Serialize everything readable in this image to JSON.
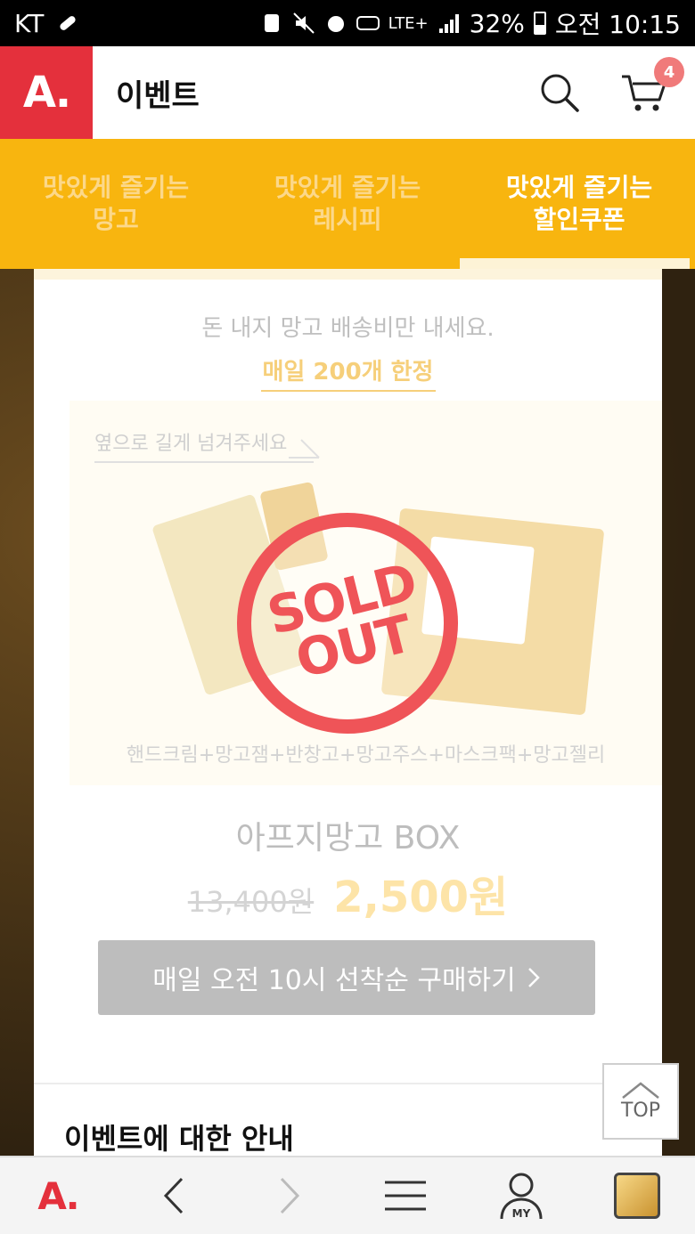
{
  "status_bar": {
    "carrier": "KT",
    "battery": "32%",
    "time": "오전 10:15",
    "network": "LTE+"
  },
  "header": {
    "logo": "A.",
    "title": "이벤트",
    "cart_count": "4"
  },
  "tabs": [
    {
      "label_line1": "맛있게 즐기는",
      "label_line2": "망고",
      "active": false
    },
    {
      "label_line1": "맛있게 즐기는",
      "label_line2": "레시피",
      "active": false
    },
    {
      "label_line1": "맛있게 즐기는",
      "label_line2": "할인쿠폰",
      "active": true
    }
  ],
  "promo": {
    "lead": "돈 내지 망고 배송비만 내세요.",
    "limit": "매일 200개 한정",
    "swipe_hint": "옆으로 길게 넘겨주세요",
    "sold_out_line1": "SOLD",
    "sold_out_line2": "OUT",
    "contents": "핸드크림+망고잼+반창고+망고주스+마스크팩+망고젤리",
    "product_name": "아프지망고 BOX",
    "original_price": "13,400원",
    "sale_price": "2,500원",
    "buy_button": "매일 오전 10시 선착순 구매하기",
    "info_title": "이벤트에 대한 안내"
  },
  "top_button": "TOP",
  "bottom_nav": {
    "logo": "A.",
    "my_label": "MY"
  },
  "colors": {
    "brand_red": "#e4303c",
    "tab_yellow": "#f8b50f",
    "sold_out_red": "#ef5458",
    "button_gray": "#bdbdbd"
  }
}
